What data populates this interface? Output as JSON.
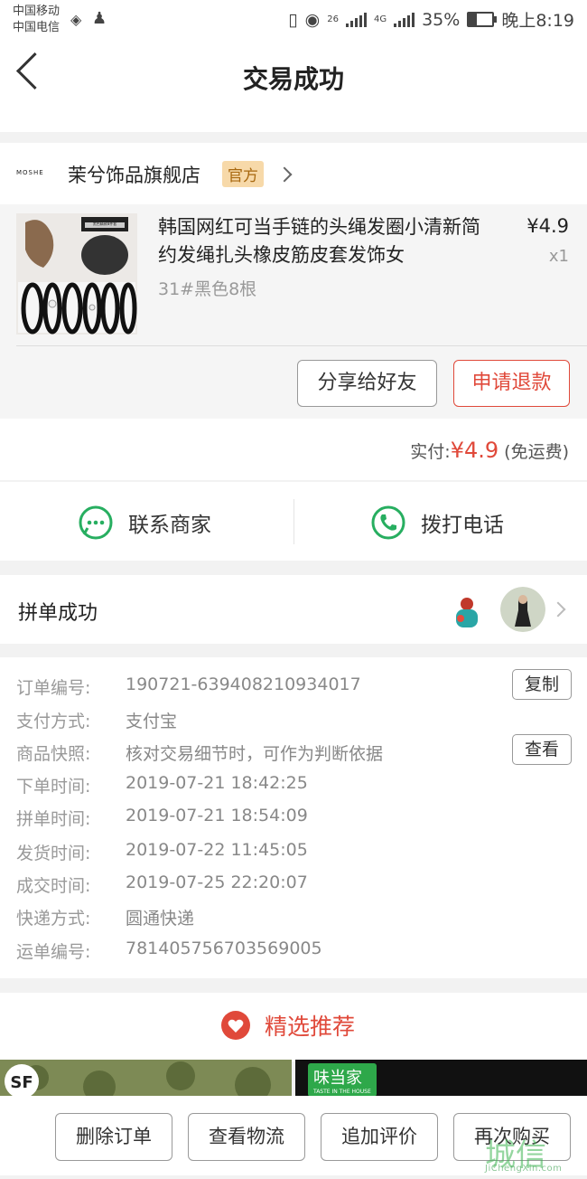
{
  "status_bar": {
    "carrier1": "中国移动",
    "carrier2": "中国电信",
    "net1": "26",
    "net2": "4G",
    "battery": "35%",
    "time": "晚上8:19"
  },
  "nav": {
    "title": "交易成功"
  },
  "store": {
    "logo_text": "MOSHE",
    "name": "茉兮饰品旗舰店",
    "badge": "官方"
  },
  "product": {
    "title": "韩国网红可当手链的头绳发圈小清新简约发绳扎头橡皮筋皮套发饰女",
    "spec": "31#黑色8根",
    "price": "¥4.9",
    "qty": "x1",
    "thumb_caption": "黑色精致8件套",
    "share_btn": "分享给好友",
    "refund_btn": "申请退款"
  },
  "payment": {
    "label": "实付:",
    "amount": "¥4.9",
    "note": "(免运费)"
  },
  "contact": {
    "merchant": "联系商家",
    "phone": "拨打电话"
  },
  "group": {
    "label": "拼单成功"
  },
  "order_info": {
    "rows": [
      {
        "key": "订单编号:",
        "value": "190721-639408210934017"
      },
      {
        "key": "支付方式:",
        "value": "支付宝"
      },
      {
        "key": "商品快照:",
        "value": "核对交易细节时，可作为判断依据"
      },
      {
        "key": "下单时间:",
        "value": "2019-07-21 18:42:25"
      },
      {
        "key": "拼单时间:",
        "value": "2019-07-21 18:54:09"
      },
      {
        "key": "发货时间:",
        "value": "2019-07-22 11:45:05"
      },
      {
        "key": "成交时间:",
        "value": "2019-07-25 22:20:07"
      },
      {
        "key": "快递方式:",
        "value": "圆通快递"
      },
      {
        "key": "运单编号:",
        "value": "781405756703569005"
      }
    ],
    "copy_btn": "复制",
    "view_btn": "查看"
  },
  "recommend": {
    "title": "精选推荐",
    "tile_right_brand": "味当家",
    "tile_right_sub": "TASTE IN THE HOUSE"
  },
  "bottom": {
    "delete": "删除订单",
    "logistics": "查看物流",
    "review": "追加评价",
    "rebuy": "再次购买"
  },
  "watermark": {
    "text": "城信",
    "url": "JiChengXin.com"
  },
  "colors": {
    "accent_red": "#e0493a",
    "green": "#27ae60",
    "badge_bg": "#f7d9a9"
  }
}
